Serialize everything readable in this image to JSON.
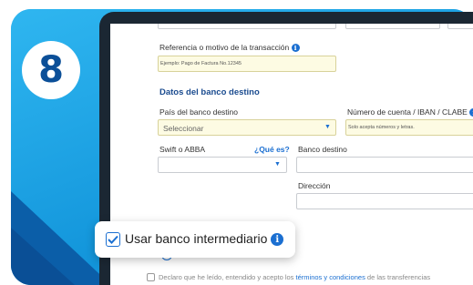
{
  "step": {
    "number": "8"
  },
  "form": {
    "reference": {
      "label": "Referencia o motivo de la transacción",
      "placeholder": "Ejemplo: Pago de Factura No.12345"
    },
    "bank_section_title": "Datos del banco destino",
    "country": {
      "label": "País del banco destino",
      "value": "Seleccionar"
    },
    "account": {
      "label": "Número de cuenta / IBAN / CLABE",
      "hint": "Solo acepta números y letras."
    },
    "swift": {
      "label": "Swift o ABBA",
      "help_link": "¿Qué es?"
    },
    "bank_name": {
      "label": "Banco destino"
    },
    "address": {
      "label": "Dirección"
    },
    "disclaimer": {
      "prefix": "Declaro que he leído, entendido y acepto los ",
      "terms_link": "términos y condiciones",
      "suffix": " de las transferencias"
    }
  },
  "intermediary": {
    "label": "Usar banco intermediario",
    "checked": true
  },
  "colors": {
    "card_blue": "#15a3e6",
    "dark_blue": "#0b4f98",
    "accent": "#1b6fd1",
    "highlight_field": "#fdfbe3"
  }
}
